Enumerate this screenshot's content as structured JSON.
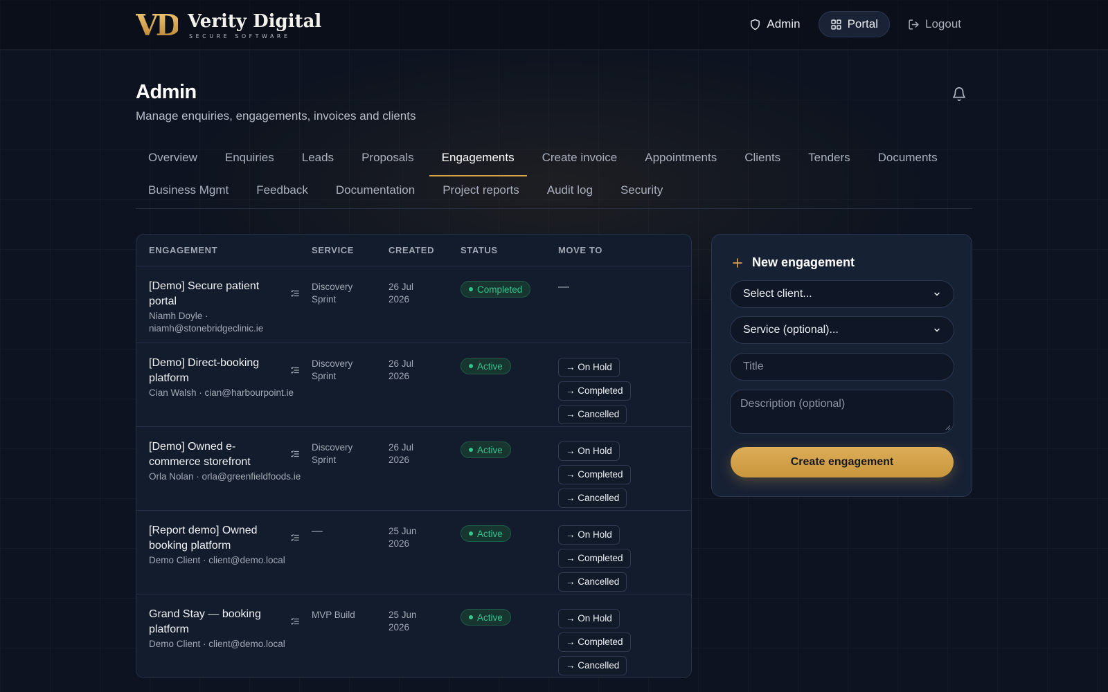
{
  "brand": {
    "mark": "VD",
    "name": "Verity Digital",
    "tagline": "SECURE SOFTWARE",
    "accent_color": "#d7a448"
  },
  "topnav": {
    "items": [
      {
        "label": "Admin",
        "icon": "shield-icon"
      },
      {
        "label": "Portal",
        "icon": "grid-icon",
        "active": true
      },
      {
        "label": "Logout",
        "icon": "logout-icon"
      }
    ]
  },
  "page": {
    "title": "Admin",
    "subtitle": "Manage enquiries, engagements, invoices and clients",
    "bell_icon": "bell-icon"
  },
  "tabs": {
    "row1": [
      "Overview",
      "Enquiries",
      "Leads",
      "Proposals",
      "Engagements",
      "Create invoice",
      "Appointments",
      "Clients",
      "Tenders",
      "Documents"
    ],
    "row2": [
      "Business Mgmt",
      "Feedback",
      "Documentation",
      "Project reports",
      "Audit log",
      "Security"
    ],
    "active": "Engagements"
  },
  "table": {
    "columns": [
      "ENGAGEMENT",
      "SERVICE",
      "CREATED",
      "STATUS",
      "MOVE TO"
    ],
    "rows": [
      {
        "title": "[Demo] Secure patient portal",
        "client": "Niamh Doyle · niamh@stonebridgeclinic.ie",
        "service": "Discovery Sprint",
        "created": "26 Jul 2026",
        "status": "Completed",
        "move_to": []
      },
      {
        "title": "[Demo] Direct-booking platform",
        "client": "Cian Walsh · cian@harbourpoint.ie",
        "service": "Discovery Sprint",
        "created": "26 Jul 2026",
        "status": "Active",
        "move_to": [
          "→ On Hold",
          "→ Completed",
          "→ Cancelled"
        ]
      },
      {
        "title": "[Demo] Owned e-commerce storefront",
        "client": "Orla Nolan · orla@greenfieldfoods.ie",
        "service": "Discovery Sprint",
        "created": "26 Jul 2026",
        "status": "Active",
        "move_to": [
          "→ On Hold",
          "→ Completed",
          "→ Cancelled"
        ]
      },
      {
        "title": "[Report demo] Owned booking platform",
        "client": "Demo Client · client@demo.local",
        "service": "—",
        "created": "25 Jun 2026",
        "status": "Active",
        "move_to": [
          "→ On Hold",
          "→ Completed",
          "→ Cancelled"
        ]
      },
      {
        "title": "Grand Stay — booking platform",
        "client": "Demo Client · client@demo.local",
        "service": "MVP Build",
        "created": "25 Jun 2026",
        "status": "Active",
        "move_to": [
          "→ On Hold",
          "→ Completed",
          "→ Cancelled"
        ]
      }
    ],
    "empty_move": "—"
  },
  "form": {
    "title": "New engagement",
    "client_select": "Select client...",
    "service_select": "Service (optional)...",
    "title_placeholder": "Title",
    "description_placeholder": "Description (optional)",
    "submit_label": "Create engagement"
  }
}
